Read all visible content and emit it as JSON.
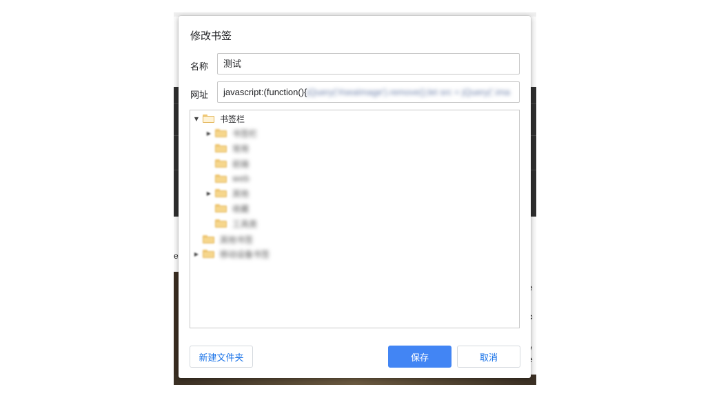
{
  "dialog": {
    "title": "修改书签",
    "name_label": "名称",
    "name_value": "测试",
    "url_label": "网址",
    "url_visible": "javascript:(function(){",
    "url_obscured": "jQuery('#seaImage').remove();let src = jQuery('.ima",
    "tree": {
      "root": {
        "label": "书签栏",
        "expanded": true
      },
      "children": [
        {
          "label": "书签栏",
          "has_children": true
        },
        {
          "label": "常用",
          "has_children": false
        },
        {
          "label": "前端",
          "has_children": false
        },
        {
          "label": "web",
          "has_children": false
        },
        {
          "label": "其他",
          "has_children": true
        },
        {
          "label": "收藏",
          "has_children": false
        },
        {
          "label": "工具类",
          "has_children": false
        }
      ],
      "others": [
        {
          "label": "其他书签",
          "has_children": false
        },
        {
          "label": "移动设备书签",
          "has_children": true
        }
      ]
    },
    "buttons": {
      "new_folder": "新建文件夹",
      "save": "保存",
      "cancel": "取消"
    }
  },
  "background": {
    "right_text": [
      "t",
      "e",
      "c",
      "r",
      "v",
      "e"
    ],
    "left_text": "e"
  },
  "colors": {
    "primary": "#4285f4",
    "link": "#1a73e8",
    "folder": "#f6d68c"
  }
}
